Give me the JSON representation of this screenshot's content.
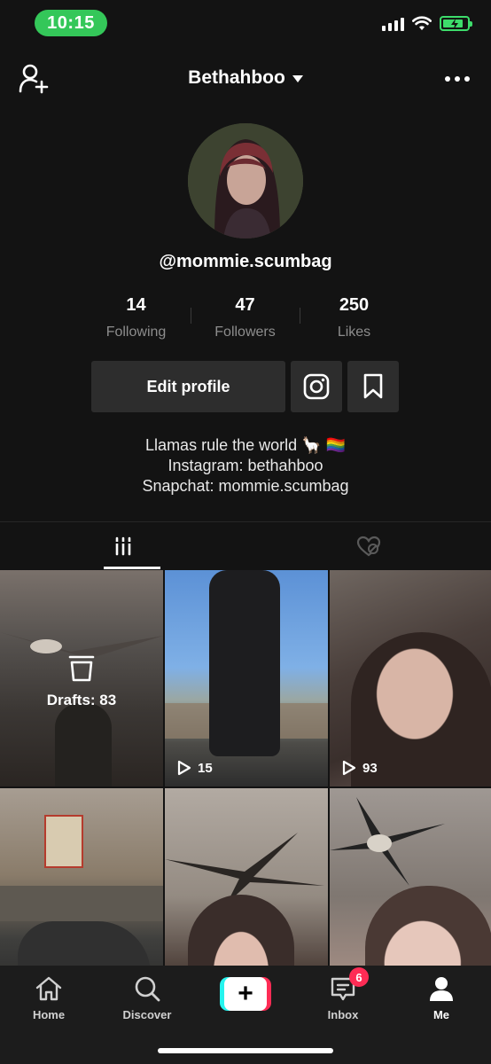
{
  "status_bar": {
    "time": "10:15"
  },
  "header": {
    "username": "Bethahboo"
  },
  "profile": {
    "handle": "@mommie.scumbag",
    "stats": [
      {
        "value": "14",
        "label": "Following"
      },
      {
        "value": "47",
        "label": "Followers"
      },
      {
        "value": "250",
        "label": "Likes"
      }
    ],
    "edit_profile_label": "Edit profile",
    "bio": [
      "Llamas rule the world 🦙 🏳️‍🌈",
      "Instagram: bethahboo",
      "Snapchat: mommie.scumbag"
    ]
  },
  "grid": {
    "drafts_label": "Drafts: 83",
    "tile2_plays": "15",
    "tile3_plays": "93"
  },
  "nav": {
    "home": "Home",
    "discover": "Discover",
    "inbox": "Inbox",
    "inbox_badge": "6",
    "me": "Me"
  },
  "colors": {
    "accent_pink": "#fe2c55",
    "accent_cyan": "#25f4ee",
    "status_green": "#34c759"
  },
  "icons": [
    "add-user-icon",
    "caret-down-icon",
    "more-icon",
    "instagram-icon",
    "bookmark-icon",
    "grid-icon",
    "liked-videos-icon",
    "drafts-icon",
    "play-icon",
    "home-icon",
    "search-icon",
    "plus-icon",
    "inbox-icon",
    "profile-icon"
  ]
}
